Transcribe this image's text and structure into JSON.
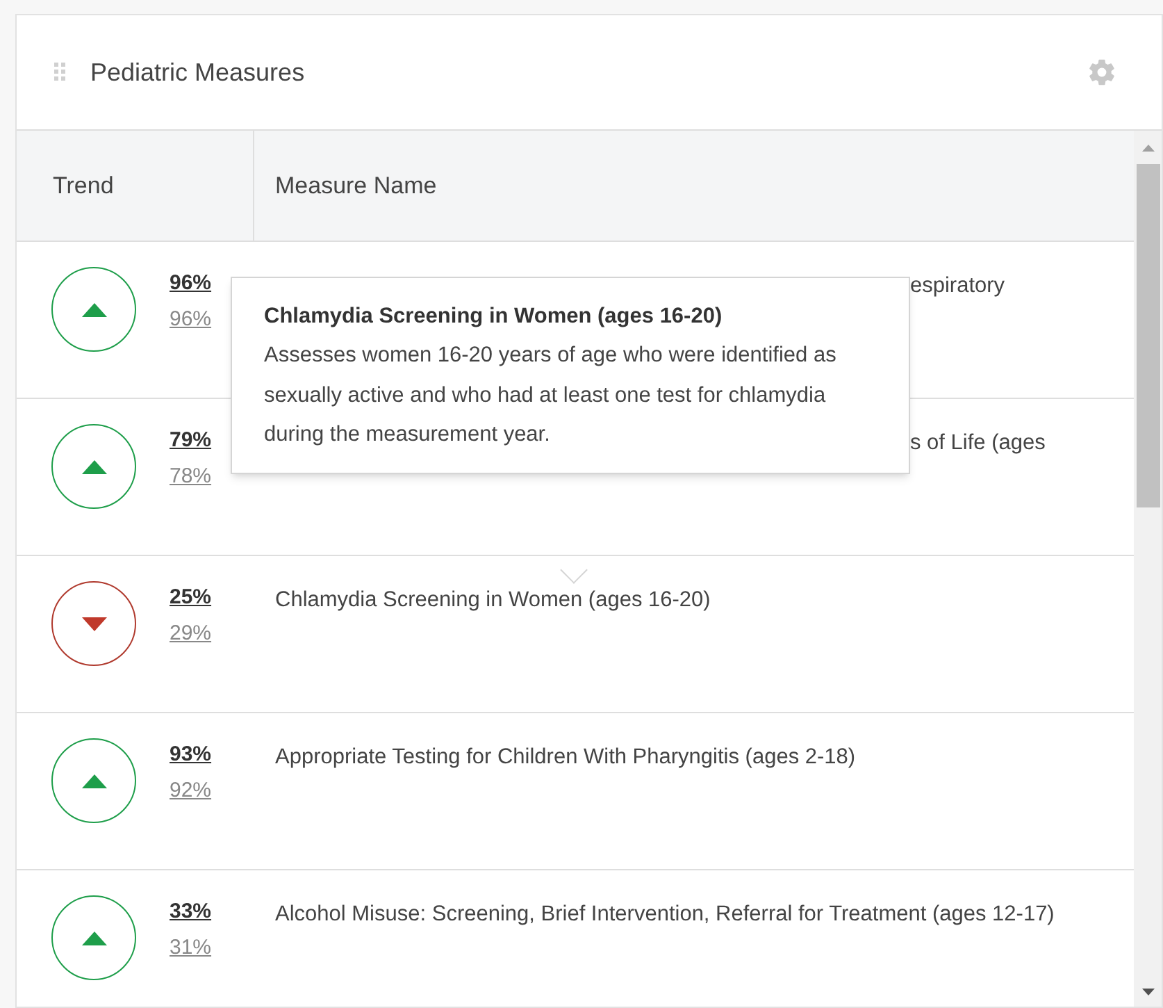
{
  "panel": {
    "title": "Pediatric Measures"
  },
  "table": {
    "columns": [
      "Trend",
      "Measure Name"
    ],
    "rows": [
      {
        "kind": "up",
        "current": "96%",
        "previous": "96%",
        "name": "espiratory",
        "partial": true
      },
      {
        "kind": "up",
        "current": "79%",
        "previous": "78%",
        "name": "s of Life (ages",
        "partial": true
      },
      {
        "kind": "down",
        "current": "25%",
        "previous": "29%",
        "name": "Chlamydia Screening in Women (ages 16-20)",
        "partial": false
      },
      {
        "kind": "up",
        "current": "93%",
        "previous": "92%",
        "name": "Appropriate Testing for Children With Pharyngitis (ages 2-18)",
        "partial": false
      },
      {
        "kind": "up",
        "current": "33%",
        "previous": "31%",
        "name": "Alcohol Misuse: Screening, Brief Intervention, Referral for Treatment (ages 12-17)",
        "partial": false
      }
    ]
  },
  "tooltip": {
    "title": "Chlamydia Screening in Women (ages 16-20)",
    "text": "Assesses women 16-20 years of age who were identified as sexually active and who had at least one test for chlamydia during the measurement year."
  }
}
